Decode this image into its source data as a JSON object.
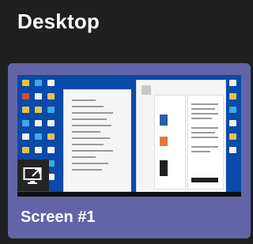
{
  "section": {
    "title": "Desktop"
  },
  "screen_card": {
    "label": "Screen #1",
    "selected": true
  },
  "icons": {
    "share": "share-screen-icon"
  },
  "colors": {
    "background": "#1f1f1f",
    "card_accent": "#6264a7",
    "desktop_wallpaper": "#0a4aa8"
  }
}
